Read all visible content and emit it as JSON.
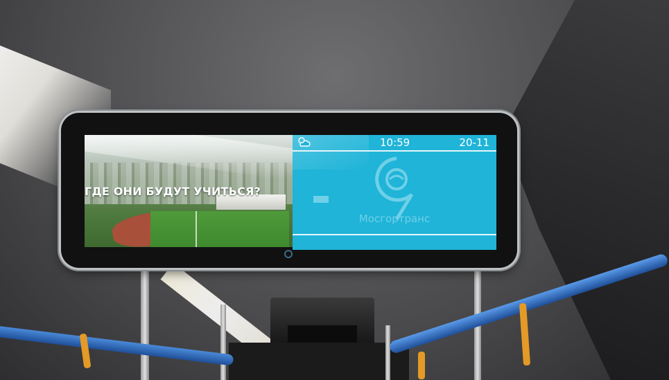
{
  "video": {
    "caption": "ГДЕ ОНИ БУДУТ УЧИТЬСЯ?"
  },
  "info_panel": {
    "weather_icon": "sun-cloud-icon",
    "time": "10:59",
    "date": "20-11",
    "brand": "Мосгортранс",
    "brand_icon": "mosgortrans-logo-icon",
    "background_color": "#1fb4d8"
  }
}
